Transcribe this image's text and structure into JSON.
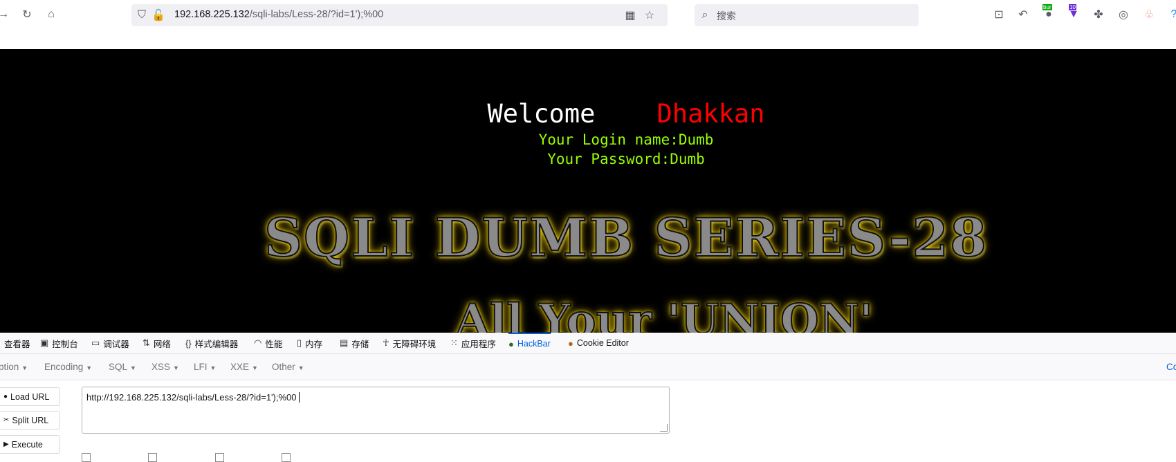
{
  "browser": {
    "url_host": "192.168.225.132",
    "url_path": "/sqli-labs/Less-28/?id=1');%00",
    "search_placeholder": "搜索",
    "ext_badge_burp": "bur",
    "ext_badge_count": "10"
  },
  "page": {
    "welcome_label": "Welcome",
    "welcome_name": "Dhakkan",
    "login_line": "Your Login name:Dumb",
    "password_line": "Your Password:Dumb",
    "banner_title": "SQLI DUMB SERIES-28",
    "banner_subtitle": "All Your 'UNION'"
  },
  "devtools": {
    "tabs": [
      "查看器",
      "控制台",
      "调试器",
      "网络",
      "样式编辑器",
      "性能",
      "内存",
      "存储",
      "无障碍环境",
      "应用程序",
      "HackBar",
      "Cookie Editor"
    ],
    "active_tab": "HackBar"
  },
  "hackbar": {
    "menu": [
      "ption",
      "Encoding",
      "SQL",
      "XSS",
      "LFI",
      "XXE",
      "Other"
    ],
    "menu_right": "Co",
    "load_url": "Load URL",
    "split_url": "Split URL",
    "execute": "Execute",
    "url_value": "http://192.168.225.132/sqli-labs/Less-28/?id=1');%00 "
  },
  "colors": {
    "page_bg": "#000000",
    "welcome_name": "#ff0000",
    "login_text": "#99ff00",
    "active_tab": "#0060df"
  }
}
